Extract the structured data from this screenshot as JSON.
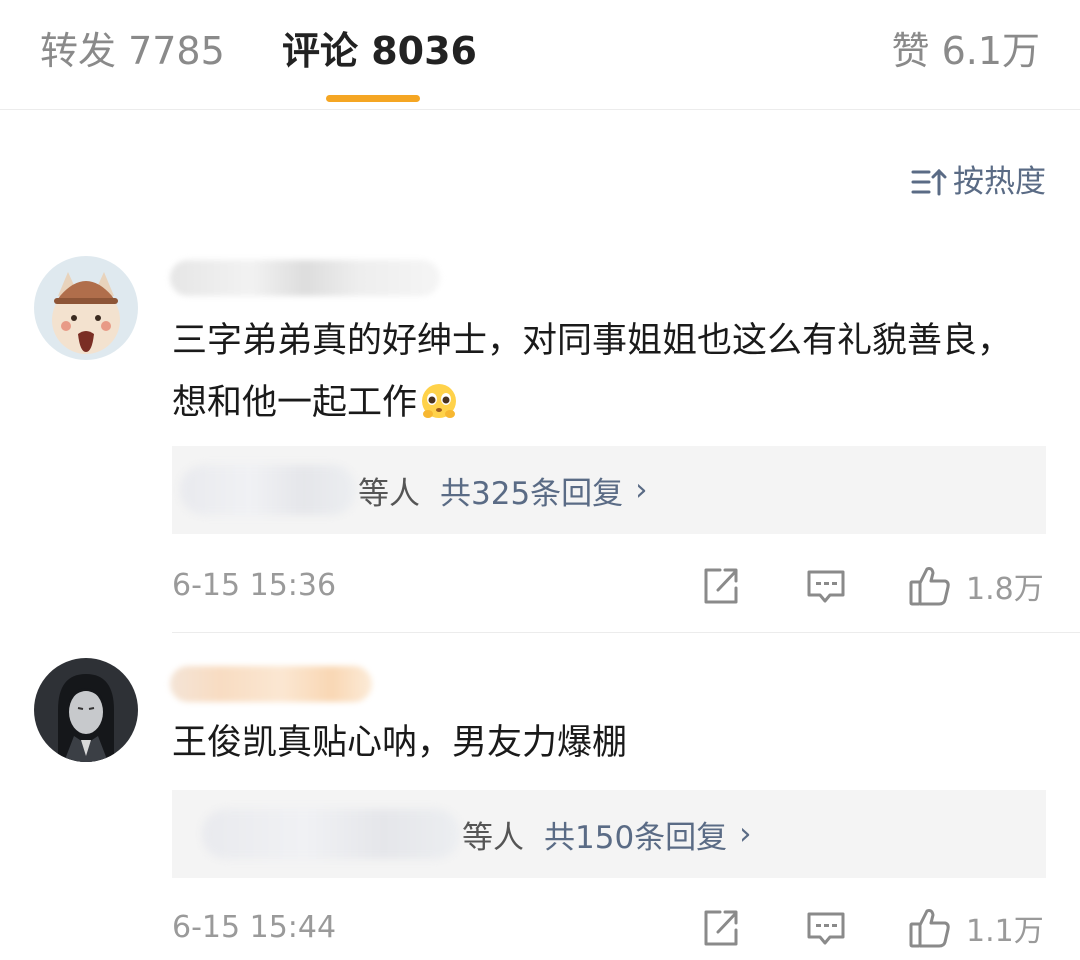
{
  "tabs": {
    "reposts": "转发 7785",
    "comments": "评论 8036",
    "likes": "赞 6.1万"
  },
  "sort": {
    "label": "按热度"
  },
  "colors": {
    "accent": "#f5a623",
    "link": "#5a6b85"
  },
  "comments": [
    {
      "text": "三字弟弟真的好绅士，对同事姐姐也这么有礼貌善良，想和他一起工作",
      "reply_others": "等人",
      "reply_count": "共325条回复",
      "reply_chevron": "›",
      "timestamp": "6-15 15:36",
      "likes": "1.8万"
    },
    {
      "text": "王俊凯真贴心呐，男友力爆棚",
      "reply_others": "等人",
      "reply_count": "共150条回复",
      "reply_chevron": "›",
      "timestamp": "6-15 15:44",
      "likes": "1.1万"
    }
  ]
}
